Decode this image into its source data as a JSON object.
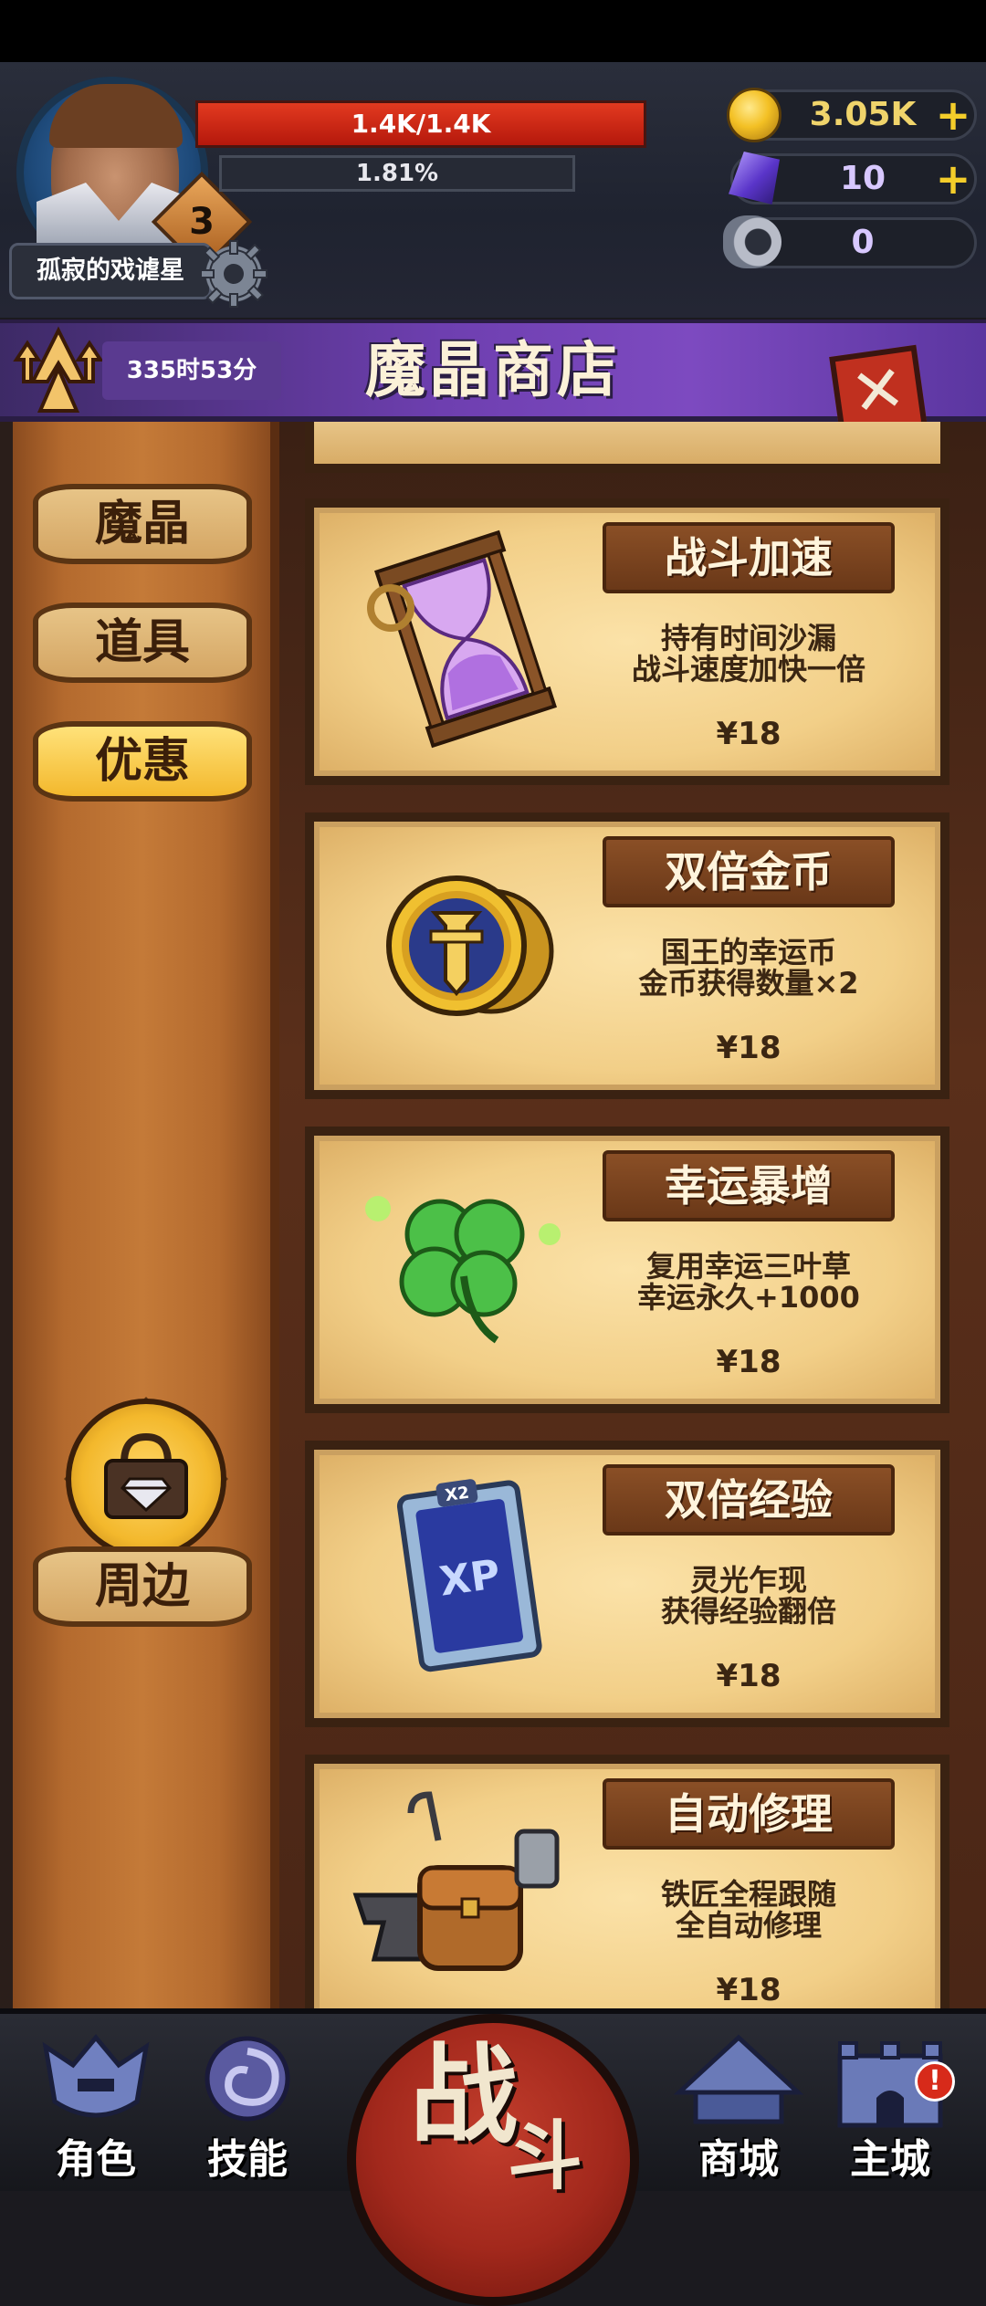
{
  "player": {
    "name": "孤寂的戏谑星",
    "level": "3",
    "hp_text": "1.4K/1.4K",
    "hp_fraction": 1.0,
    "xp_text": "1.81%"
  },
  "resources": {
    "gold": "3.05K",
    "crystal": "10",
    "ram": "0",
    "plus": "+"
  },
  "banner": {
    "timer": "335时53分",
    "title": "魔晶商店",
    "close_symbol": "✕"
  },
  "sidebar": {
    "tabs": [
      {
        "label": "魔晶",
        "active": false
      },
      {
        "label": "道具",
        "active": false
      },
      {
        "label": "优惠",
        "active": true
      }
    ],
    "merch_label": "周边"
  },
  "cards": [
    {
      "title": "战斗加速",
      "desc_line1": "持有时间沙漏",
      "desc_line2": "战斗速度加快一倍",
      "price": "¥18",
      "icon": "hourglass-icon"
    },
    {
      "title": "双倍金币",
      "desc_line1": "国王的幸运币",
      "desc_line2": "金币获得数量×2",
      "price": "¥18",
      "icon": "gold-coins-icon"
    },
    {
      "title": "幸运暴增",
      "desc_line1": "复用幸运三叶草",
      "desc_line2": "幸运永久+1000",
      "price": "¥18",
      "icon": "clover-icon"
    },
    {
      "title": "双倍经验",
      "desc_line1": "灵光乍现",
      "desc_line2": "获得经验翻倍",
      "price": "¥18",
      "icon": "xp-card-icon",
      "art_text": "XP",
      "art_badge": "X2"
    },
    {
      "title": "自动修理",
      "desc_line1": "铁匠全程跟随",
      "desc_line2": "全自动修理",
      "price": "¥18",
      "icon": "anvil-bag-icon"
    }
  ],
  "nav": {
    "role": "角色",
    "skill": "技能",
    "battle_1": "战",
    "battle_2": "斗",
    "mall": "商城",
    "city": "主城",
    "city_badge": "!"
  },
  "colors": {
    "banner_purple": "#6e3fb0",
    "hp_red": "#d82a16",
    "gold_accent": "#f4cd2a",
    "active_tab": "#f3b82c",
    "battle_red": "#a2281c"
  }
}
